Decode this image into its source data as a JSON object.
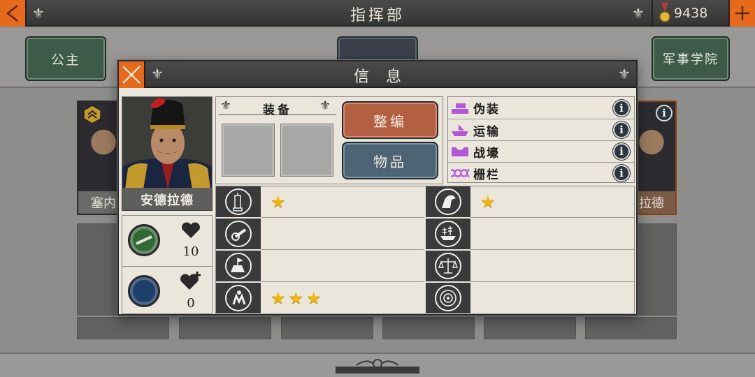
{
  "top_bar": {
    "title": "指挥部",
    "coins": "9438"
  },
  "background": {
    "left_plaque": "公主",
    "right_plaque": "军事学院",
    "left_card_name": "塞内",
    "right_card_name": "拉德"
  },
  "modal": {
    "title": "信息",
    "hero": {
      "name": "安德拉德",
      "health": "10",
      "health_bonus": "0"
    },
    "equipment": {
      "heading": "装备",
      "reorganize_label": "整编",
      "items_label": "物品"
    },
    "traits": [
      {
        "icon": "bricks-icon",
        "label": "伪装",
        "color": "#b257d6"
      },
      {
        "icon": "ship-icon",
        "label": "运输",
        "color": "#b257d6"
      },
      {
        "icon": "trench-icon",
        "label": "战壕",
        "color": "#b257d6"
      },
      {
        "icon": "fence-icon",
        "label": "栅栏",
        "color": "#b257d6"
      }
    ],
    "skills_left": [
      {
        "icon": "infantry-icon",
        "stars": 1
      },
      {
        "icon": "cannon-icon",
        "stars": 0
      },
      {
        "icon": "fort-icon",
        "stars": 0
      },
      {
        "icon": "march-icon",
        "stars": 3
      }
    ],
    "skills_right": [
      {
        "icon": "horse-icon",
        "stars": 1
      },
      {
        "icon": "warship-icon",
        "stars": 0
      },
      {
        "icon": "scales-icon",
        "stars": 0
      },
      {
        "icon": "target-icon",
        "stars": 0
      }
    ]
  },
  "colors": {
    "accent": "#e76a1c",
    "reorganize": "#b35f42",
    "items": "#4c6474",
    "star": "#f2b60f"
  }
}
